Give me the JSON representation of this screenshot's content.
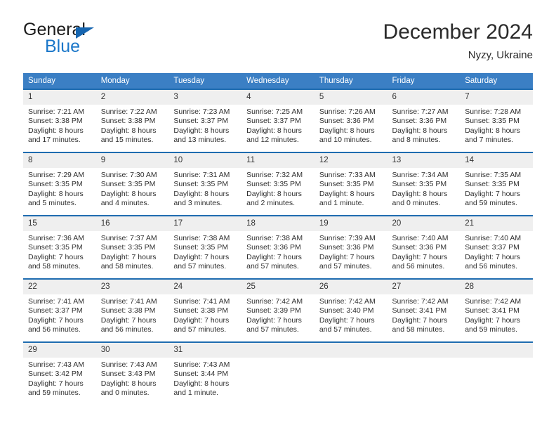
{
  "brand": {
    "name_top": "General",
    "name_bottom": "Blue",
    "accent_color": "#1b77c9",
    "triangle_color": "#1565b0"
  },
  "header": {
    "title": "December 2024",
    "location": "Nyzy, Ukraine"
  },
  "calendar": {
    "header_bg": "#3b7fc4",
    "row_border_color": "#1f6cb0",
    "daynum_bg": "#efefef",
    "weekday_headers": [
      "Sunday",
      "Monday",
      "Tuesday",
      "Wednesday",
      "Thursday",
      "Friday",
      "Saturday"
    ],
    "labels": {
      "sunrise_prefix": "Sunrise:",
      "sunset_prefix": "Sunset:",
      "daylight_prefix": "Daylight:"
    },
    "weeks": [
      [
        {
          "day": "1",
          "sunrise": "Sunrise: 7:21 AM",
          "sunset": "Sunset: 3:38 PM",
          "daylight": "Daylight: 8 hours and 17 minutes."
        },
        {
          "day": "2",
          "sunrise": "Sunrise: 7:22 AM",
          "sunset": "Sunset: 3:38 PM",
          "daylight": "Daylight: 8 hours and 15 minutes."
        },
        {
          "day": "3",
          "sunrise": "Sunrise: 7:23 AM",
          "sunset": "Sunset: 3:37 PM",
          "daylight": "Daylight: 8 hours and 13 minutes."
        },
        {
          "day": "4",
          "sunrise": "Sunrise: 7:25 AM",
          "sunset": "Sunset: 3:37 PM",
          "daylight": "Daylight: 8 hours and 12 minutes."
        },
        {
          "day": "5",
          "sunrise": "Sunrise: 7:26 AM",
          "sunset": "Sunset: 3:36 PM",
          "daylight": "Daylight: 8 hours and 10 minutes."
        },
        {
          "day": "6",
          "sunrise": "Sunrise: 7:27 AM",
          "sunset": "Sunset: 3:36 PM",
          "daylight": "Daylight: 8 hours and 8 minutes."
        },
        {
          "day": "7",
          "sunrise": "Sunrise: 7:28 AM",
          "sunset": "Sunset: 3:35 PM",
          "daylight": "Daylight: 8 hours and 7 minutes."
        }
      ],
      [
        {
          "day": "8",
          "sunrise": "Sunrise: 7:29 AM",
          "sunset": "Sunset: 3:35 PM",
          "daylight": "Daylight: 8 hours and 5 minutes."
        },
        {
          "day": "9",
          "sunrise": "Sunrise: 7:30 AM",
          "sunset": "Sunset: 3:35 PM",
          "daylight": "Daylight: 8 hours and 4 minutes."
        },
        {
          "day": "10",
          "sunrise": "Sunrise: 7:31 AM",
          "sunset": "Sunset: 3:35 PM",
          "daylight": "Daylight: 8 hours and 3 minutes."
        },
        {
          "day": "11",
          "sunrise": "Sunrise: 7:32 AM",
          "sunset": "Sunset: 3:35 PM",
          "daylight": "Daylight: 8 hours and 2 minutes."
        },
        {
          "day": "12",
          "sunrise": "Sunrise: 7:33 AM",
          "sunset": "Sunset: 3:35 PM",
          "daylight": "Daylight: 8 hours and 1 minute."
        },
        {
          "day": "13",
          "sunrise": "Sunrise: 7:34 AM",
          "sunset": "Sunset: 3:35 PM",
          "daylight": "Daylight: 8 hours and 0 minutes."
        },
        {
          "day": "14",
          "sunrise": "Sunrise: 7:35 AM",
          "sunset": "Sunset: 3:35 PM",
          "daylight": "Daylight: 7 hours and 59 minutes."
        }
      ],
      [
        {
          "day": "15",
          "sunrise": "Sunrise: 7:36 AM",
          "sunset": "Sunset: 3:35 PM",
          "daylight": "Daylight: 7 hours and 58 minutes."
        },
        {
          "day": "16",
          "sunrise": "Sunrise: 7:37 AM",
          "sunset": "Sunset: 3:35 PM",
          "daylight": "Daylight: 7 hours and 58 minutes."
        },
        {
          "day": "17",
          "sunrise": "Sunrise: 7:38 AM",
          "sunset": "Sunset: 3:35 PM",
          "daylight": "Daylight: 7 hours and 57 minutes."
        },
        {
          "day": "18",
          "sunrise": "Sunrise: 7:38 AM",
          "sunset": "Sunset: 3:36 PM",
          "daylight": "Daylight: 7 hours and 57 minutes."
        },
        {
          "day": "19",
          "sunrise": "Sunrise: 7:39 AM",
          "sunset": "Sunset: 3:36 PM",
          "daylight": "Daylight: 7 hours and 57 minutes."
        },
        {
          "day": "20",
          "sunrise": "Sunrise: 7:40 AM",
          "sunset": "Sunset: 3:36 PM",
          "daylight": "Daylight: 7 hours and 56 minutes."
        },
        {
          "day": "21",
          "sunrise": "Sunrise: 7:40 AM",
          "sunset": "Sunset: 3:37 PM",
          "daylight": "Daylight: 7 hours and 56 minutes."
        }
      ],
      [
        {
          "day": "22",
          "sunrise": "Sunrise: 7:41 AM",
          "sunset": "Sunset: 3:37 PM",
          "daylight": "Daylight: 7 hours and 56 minutes."
        },
        {
          "day": "23",
          "sunrise": "Sunrise: 7:41 AM",
          "sunset": "Sunset: 3:38 PM",
          "daylight": "Daylight: 7 hours and 56 minutes."
        },
        {
          "day": "24",
          "sunrise": "Sunrise: 7:41 AM",
          "sunset": "Sunset: 3:38 PM",
          "daylight": "Daylight: 7 hours and 57 minutes."
        },
        {
          "day": "25",
          "sunrise": "Sunrise: 7:42 AM",
          "sunset": "Sunset: 3:39 PM",
          "daylight": "Daylight: 7 hours and 57 minutes."
        },
        {
          "day": "26",
          "sunrise": "Sunrise: 7:42 AM",
          "sunset": "Sunset: 3:40 PM",
          "daylight": "Daylight: 7 hours and 57 minutes."
        },
        {
          "day": "27",
          "sunrise": "Sunrise: 7:42 AM",
          "sunset": "Sunset: 3:41 PM",
          "daylight": "Daylight: 7 hours and 58 minutes."
        },
        {
          "day": "28",
          "sunrise": "Sunrise: 7:42 AM",
          "sunset": "Sunset: 3:41 PM",
          "daylight": "Daylight: 7 hours and 59 minutes."
        }
      ],
      [
        {
          "day": "29",
          "sunrise": "Sunrise: 7:43 AM",
          "sunset": "Sunset: 3:42 PM",
          "daylight": "Daylight: 7 hours and 59 minutes."
        },
        {
          "day": "30",
          "sunrise": "Sunrise: 7:43 AM",
          "sunset": "Sunset: 3:43 PM",
          "daylight": "Daylight: 8 hours and 0 minutes."
        },
        {
          "day": "31",
          "sunrise": "Sunrise: 7:43 AM",
          "sunset": "Sunset: 3:44 PM",
          "daylight": "Daylight: 8 hours and 1 minute."
        },
        {
          "day": "",
          "sunrise": "",
          "sunset": "",
          "daylight": ""
        },
        {
          "day": "",
          "sunrise": "",
          "sunset": "",
          "daylight": ""
        },
        {
          "day": "",
          "sunrise": "",
          "sunset": "",
          "daylight": ""
        },
        {
          "day": "",
          "sunrise": "",
          "sunset": "",
          "daylight": ""
        }
      ]
    ]
  }
}
